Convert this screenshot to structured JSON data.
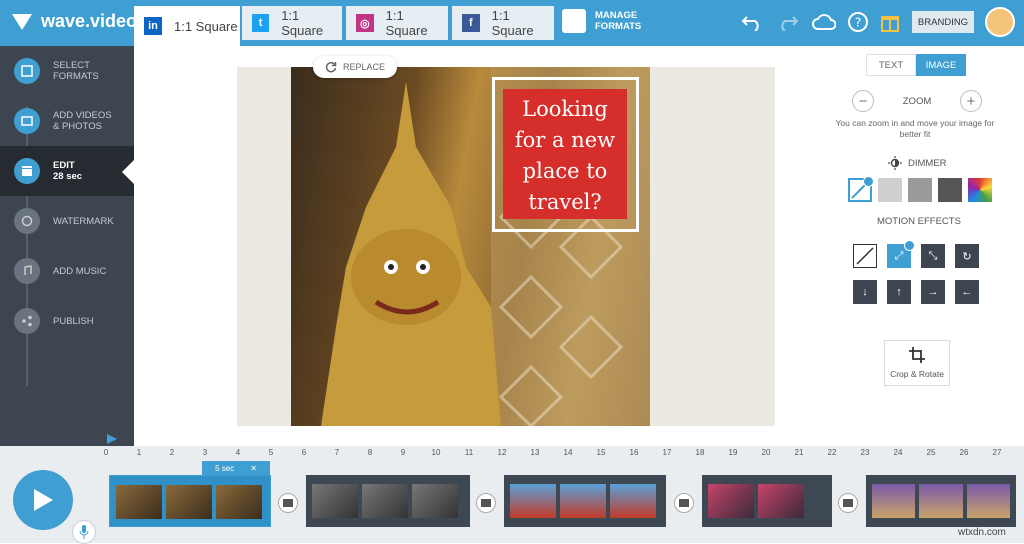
{
  "app": {
    "name": "wave.video"
  },
  "tabs": [
    {
      "label": "1:1 Square",
      "network": "linkedin",
      "icon": "in",
      "color": "#0a66c2"
    },
    {
      "label": "1:1 Square",
      "network": "twitter",
      "icon": "t",
      "color": "#1da1f2"
    },
    {
      "label": "1:1 Square",
      "network": "instagram",
      "icon": "◎",
      "color": "#c13584"
    },
    {
      "label": "1:1 Square",
      "network": "facebook",
      "icon": "f",
      "color": "#3b5998"
    }
  ],
  "manage_formats": {
    "line1": "MANAGE",
    "line2": "FORMATS"
  },
  "branding_label": "BRANDING",
  "steps": [
    {
      "line1": "SELECT",
      "line2": "FORMATS"
    },
    {
      "line1": "ADD VIDEOS",
      "line2": "& PHOTOS"
    },
    {
      "line1": "EDIT",
      "line2": "28 sec"
    },
    {
      "line1": "WATERMARK",
      "line2": ""
    },
    {
      "line1": "ADD MUSIC",
      "line2": ""
    },
    {
      "line1": "PUBLISH",
      "line2": ""
    }
  ],
  "canvas": {
    "replace_label": "REPLACE",
    "overlay_text": [
      "Looking",
      "for a new",
      "place to",
      "travel?"
    ]
  },
  "panel": {
    "tab_text": "TEXT",
    "tab_image": "IMAGE",
    "zoom_label": "ZOOM",
    "zoom_minus": "−",
    "zoom_plus": "+",
    "zoom_hint": "You can zoom in and move your image for better fit",
    "dimmer_label": "DIMMER",
    "motion_label": "MOTION EFFECTS",
    "crop_label": "Crop & Rotate"
  },
  "timeline": {
    "ticks": [
      "0",
      "1",
      "2",
      "3",
      "4",
      "5",
      "6",
      "7",
      "8",
      "9",
      "10",
      "11",
      "12",
      "13",
      "14",
      "15",
      "16",
      "17",
      "18",
      "19",
      "20",
      "21",
      "22",
      "23",
      "24",
      "25",
      "26",
      "27"
    ],
    "clip_duration": "5 sec"
  },
  "watermark": "wtxdn.com"
}
